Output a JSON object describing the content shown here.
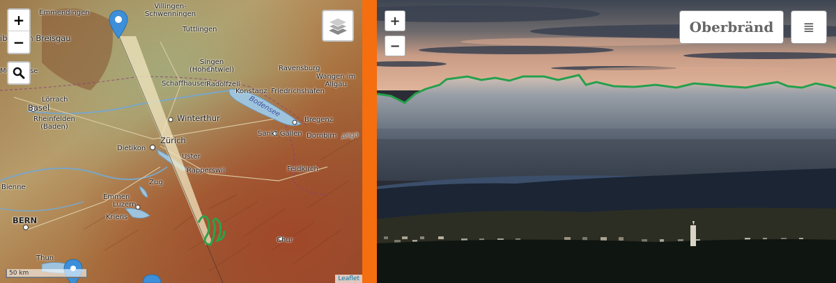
{
  "map": {
    "zoom_in_label": "+",
    "zoom_out_label": "−",
    "search_icon": "search-icon",
    "layers_icon": "layers-icon",
    "scale_label": "50 km",
    "attribution": "Leaflet",
    "route_color": "#e8dcb0",
    "ridge_color": "#2ca24a",
    "marker_color": "#3d8fd9",
    "labels": {
      "emmendingen": "Emmendingen",
      "villingen": "Villingen-\nSchwenningen",
      "freiburg": "iburg im Breisgau",
      "tuttlingen": "Tuttlingen",
      "singen": "Singen\n(Hohentwiel)",
      "ravensburg": "Ravensburg",
      "wangen": "Wangen im\nAllgäu",
      "schaffhausen": "Schaffhausen",
      "radolfzell": "Radolfzell",
      "konstanz": "Konstanz",
      "friedrichshafen": "Friedrichshafen",
      "loerrach": "Lörrach",
      "basel": "Basel",
      "rheinfelden": "Rheinfelden\n(Baden)",
      "winterthur": "Winterthur",
      "bodensee": "Bodensee",
      "bregenz": "Bregenz",
      "dornbirn": "Dornbirn",
      "sanktgallen": "Sankt Gallen",
      "allga": "Allga",
      "dietikon": "Dietikon",
      "zuerich": "Zürich",
      "uster": "Uster",
      "rapperswil": "Rapperswil",
      "feldkirch": "Feldkirch",
      "zug": "Zug",
      "bienne": "Bienne",
      "emmen": "Emmen",
      "luzern": "Luzern",
      "kriens": "Kriens",
      "bern": "BERN",
      "chur": "Chur",
      "thun": "Thun",
      "mse": "Mu",
      "se": "se"
    }
  },
  "divider_color": "#f56e0f",
  "photo": {
    "zoom_in_label": "+",
    "zoom_out_label": "−",
    "title": "Oberbränd",
    "menu_icon": "≣",
    "skyline_color": "#25a04c"
  }
}
